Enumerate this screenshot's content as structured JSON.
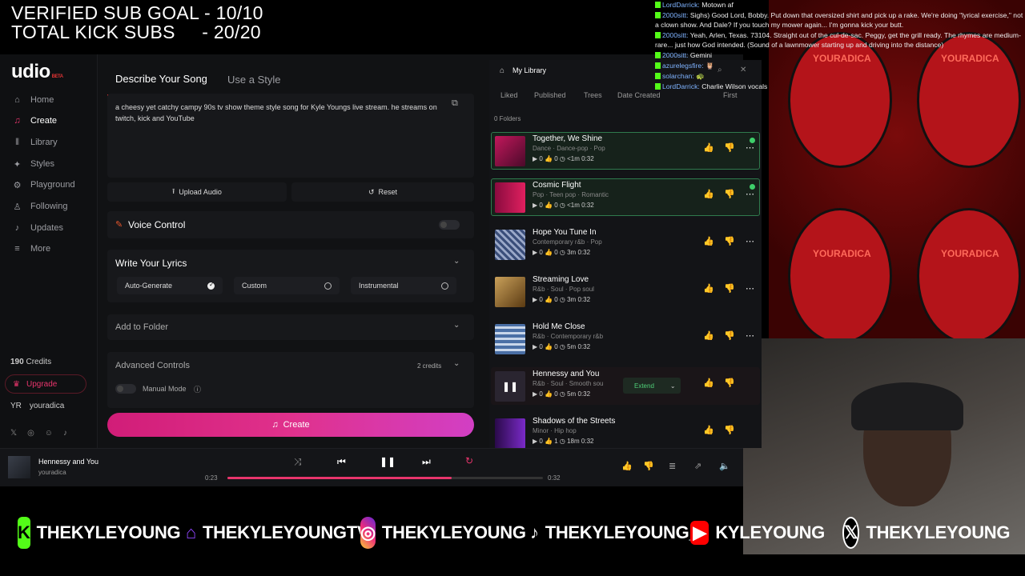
{
  "overlay": {
    "goal_line1": "VERIFIED SUB GOAL - 10/10",
    "goal_line2": "TOTAL KICK SUBS     - 20/20"
  },
  "sidebar": {
    "logo": "udio",
    "logo_badge": "BETA",
    "items": [
      {
        "label": "Home",
        "icon": "home-icon"
      },
      {
        "label": "Create",
        "icon": "create-icon"
      },
      {
        "label": "Library",
        "icon": "library-icon"
      },
      {
        "label": "Styles",
        "icon": "styles-icon"
      },
      {
        "label": "Playground",
        "icon": "playground-icon"
      },
      {
        "label": "Following",
        "icon": "following-icon"
      },
      {
        "label": "Updates",
        "icon": "bell-icon"
      },
      {
        "label": "More",
        "icon": "menu-icon"
      }
    ],
    "credits_value": "190",
    "credits_label": "Credits",
    "upgrade": "Upgrade",
    "user_initials": "YR",
    "username": "youradica"
  },
  "create": {
    "tab_describe": "Describe Your Song",
    "tab_style": "Use a Style",
    "prompt": "a cheesy yet catchy campy 90s tv show theme  style song for Kyle Youngs live stream. he streams on twitch, kick and YouTube",
    "upload_audio": "Upload Audio",
    "reset": "Reset",
    "voice_control": "Voice Control",
    "write_lyrics": "Write Your Lyrics",
    "lyric_options": [
      "Auto-Generate",
      "Custom",
      "Instrumental"
    ],
    "add_to_folder": "Add to Folder",
    "advanced": "Advanced Controls",
    "advanced_cost": "2 credits",
    "manual_mode": "Manual Mode",
    "create_button": "Create"
  },
  "library": {
    "title": "My Library",
    "filters": [
      "Liked",
      "Published",
      "Trees",
      "Date Created",
      "First"
    ],
    "folders": "0 Folders",
    "songs": [
      {
        "title": "Together, We Shine",
        "tags": "Dance  ·  Dance-pop  ·  Pop",
        "stats": "▶ 0   👍 0   ◷ <1m  0:32",
        "new": true
      },
      {
        "title": "Cosmic Flight",
        "tags": "Pop  ·  Teen pop  ·  Romantic",
        "stats": "▶ 0   👍 0   ◷ <1m  0:32",
        "new": true
      },
      {
        "title": "Hope You Tune In",
        "tags": "Contemporary r&b  ·  Pop",
        "stats": "▶ 0   👍 0   ◷ 3m   0:32"
      },
      {
        "title": "Streaming Love",
        "tags": "R&b  ·  Soul  ·  Pop soul",
        "stats": "▶ 0   👍 0   ◷ 3m   0:32"
      },
      {
        "title": "Hold Me Close",
        "tags": "R&b  ·  Contemporary r&b",
        "stats": "▶ 0   👍 0   ◷ 5m   0:32"
      },
      {
        "title": "Hennessy and You",
        "tags": "R&b  ·  Soul  ·  Smooth sou",
        "stats": "▶ 0   👍 0   ◷ 5m   0:32"
      },
      {
        "title": "Shadows of the Streets",
        "tags": "Minor  ·  Hip hop",
        "stats": "▶ 0   👍 1   ◷ 18m  0:32"
      }
    ],
    "extend": "Extend"
  },
  "player": {
    "title": "Hennessy and You",
    "artist": "youradica",
    "time_current": "0:23",
    "time_total": "0:32",
    "progress": 0.71
  },
  "chat": [
    {
      "user": "LordDarrick",
      "text": "Motown af"
    },
    {
      "user": "2000sitt",
      "text": "Sighs) Good Lord, Bobby. Put down that oversized shirt and pick up a rake. We're doing \"lyrical exercise,\" not a clown show. And Dale? If you touch my mower again... I'm gonna kick your butt."
    },
    {
      "user": "2000sitt",
      "text": "Yeah, Arlen, Texas. 73104. Straight out of the cul-de-sac. Peggy, get the grill ready. The rhymes are medium-rare... just how God intended. (Sound of a lawnmower starting up and driving into the distance)"
    },
    {
      "user": "2000sitt",
      "text": "Gemini"
    },
    {
      "user": "azurelegsfire",
      "text": "🦉"
    },
    {
      "user": "solarchan",
      "text": "🐢"
    },
    {
      "user": "LordDarrick",
      "text": "Charlie Wilson vocals"
    }
  ],
  "webcam_caps": [
    "YOURADICA",
    "YOURADICA",
    "YOURADICA",
    "YOURADICA"
  ],
  "social": [
    {
      "platform": "kick",
      "handle": "THEKYLEYOUNG",
      "color": "#53fc18"
    },
    {
      "platform": "twitch",
      "handle": "THEKYLEYOUNGTV",
      "color": "#9146ff"
    },
    {
      "platform": "instagram",
      "handle": "THEKYLEYOUNG",
      "color": "#e1306c"
    },
    {
      "platform": "tiktok",
      "handle": "THEKYLEYOUNG_",
      "color": "#ffffff"
    },
    {
      "platform": "youtube",
      "handle": "KYLEYOUNG",
      "color": "#ff0000"
    },
    {
      "platform": "x",
      "handle": "THEKYLEYOUNG",
      "color": "#ffffff"
    }
  ]
}
